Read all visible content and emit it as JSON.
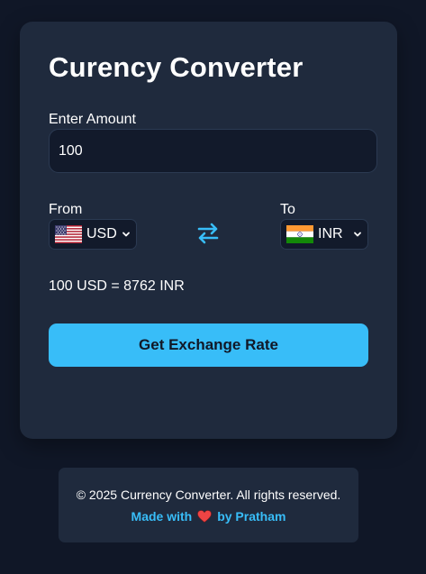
{
  "converter": {
    "title": "Curency Converter",
    "amount_label": "Enter Amount",
    "amount_value": "100",
    "from_label": "From",
    "to_label": "To",
    "from_currency": {
      "code": "USD",
      "flag": "us-flag-icon",
      "options": [
        "USD"
      ]
    },
    "to_currency": {
      "code": "INR",
      "flag": "india-flag-icon",
      "options": [
        "INR"
      ]
    },
    "swap_icon": "swap-arrows-icon",
    "result_text": "100 USD = 8762 INR",
    "button_label": "Get Exchange Rate"
  },
  "footer": {
    "copyright": "© 2025 Currency Converter. All rights reserved.",
    "made_with": "Made with",
    "heart_icon": "heart-icon",
    "by_author": "by Pratham"
  },
  "colors": {
    "page_bg": "#101727",
    "card_bg": "#1f2a3d",
    "input_bg": "#121a2b",
    "accent": "#38bdf8",
    "heart": "#ef4444"
  }
}
